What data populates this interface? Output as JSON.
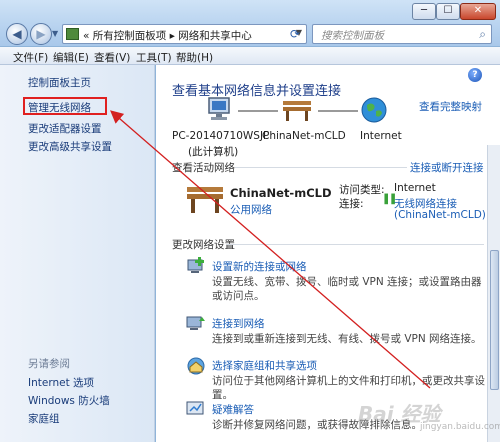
{
  "window": {
    "controls": {
      "minimize": "─",
      "maximize": "☐",
      "close": "✕"
    }
  },
  "nav": {
    "back": "◀",
    "forward": "▶",
    "address_crumbs": "« 所有控制面板项 ▸ 网络和共享中心",
    "address_dropdown": "▼",
    "refresh": "⟳",
    "search_placeholder": "搜索控制面板"
  },
  "menu": {
    "items": [
      "文件(F)",
      "编辑(E)",
      "查看(V)",
      "工具(T)",
      "帮助(H)"
    ]
  },
  "sidebar": {
    "home": "控制面板主页",
    "links": [
      "管理无线网络",
      "更改适配器设置",
      "更改高级共享设置"
    ],
    "see_also_title": "另请参阅",
    "see_also": [
      "Internet 选项",
      "Windows 防火墙",
      "家庭组"
    ]
  },
  "main": {
    "title": "查看基本网络信息并设置连接",
    "view_full_map": "查看完整映射",
    "nodes": {
      "computer": "PC-20140710WSJP",
      "computer_sub": "(此计算机)",
      "network": "ChinaNet-mCLD",
      "internet": "Internet"
    },
    "active_title": "查看活动网络",
    "connect_disconnect": "连接或断开连接",
    "active_network": {
      "name": "ChinaNet-mCLD",
      "type": "公用网络",
      "access_label": "访问类型:",
      "access_value": "Internet",
      "connection_label": "连接:",
      "connection_value": "无线网络连接",
      "connection_sub": "(ChinaNet-mCLD)"
    },
    "change_title": "更改网络设置",
    "tasks": [
      {
        "title": "设置新的连接或网络",
        "desc": "设置无线、宽带、拨号、临时或 VPN 连接；或设置路由器或访问点。"
      },
      {
        "title": "连接到网络",
        "desc": "连接到或重新连接到无线、有线、拨号或 VPN 网络连接。"
      },
      {
        "title": "选择家庭组和共享选项",
        "desc": "访问位于其他网络计算机上的文件和打印机，或更改共享设置。"
      },
      {
        "title": "疑难解答",
        "desc": "诊断并修复网络问题，或获得故障排除信息。"
      }
    ]
  },
  "watermark": {
    "text": "Bai 经验",
    "sub": "jingyan.baidu.com"
  },
  "colors": {
    "highlight_box": "#e02020",
    "arrow": "#d32020",
    "link": "#1a5db5"
  }
}
